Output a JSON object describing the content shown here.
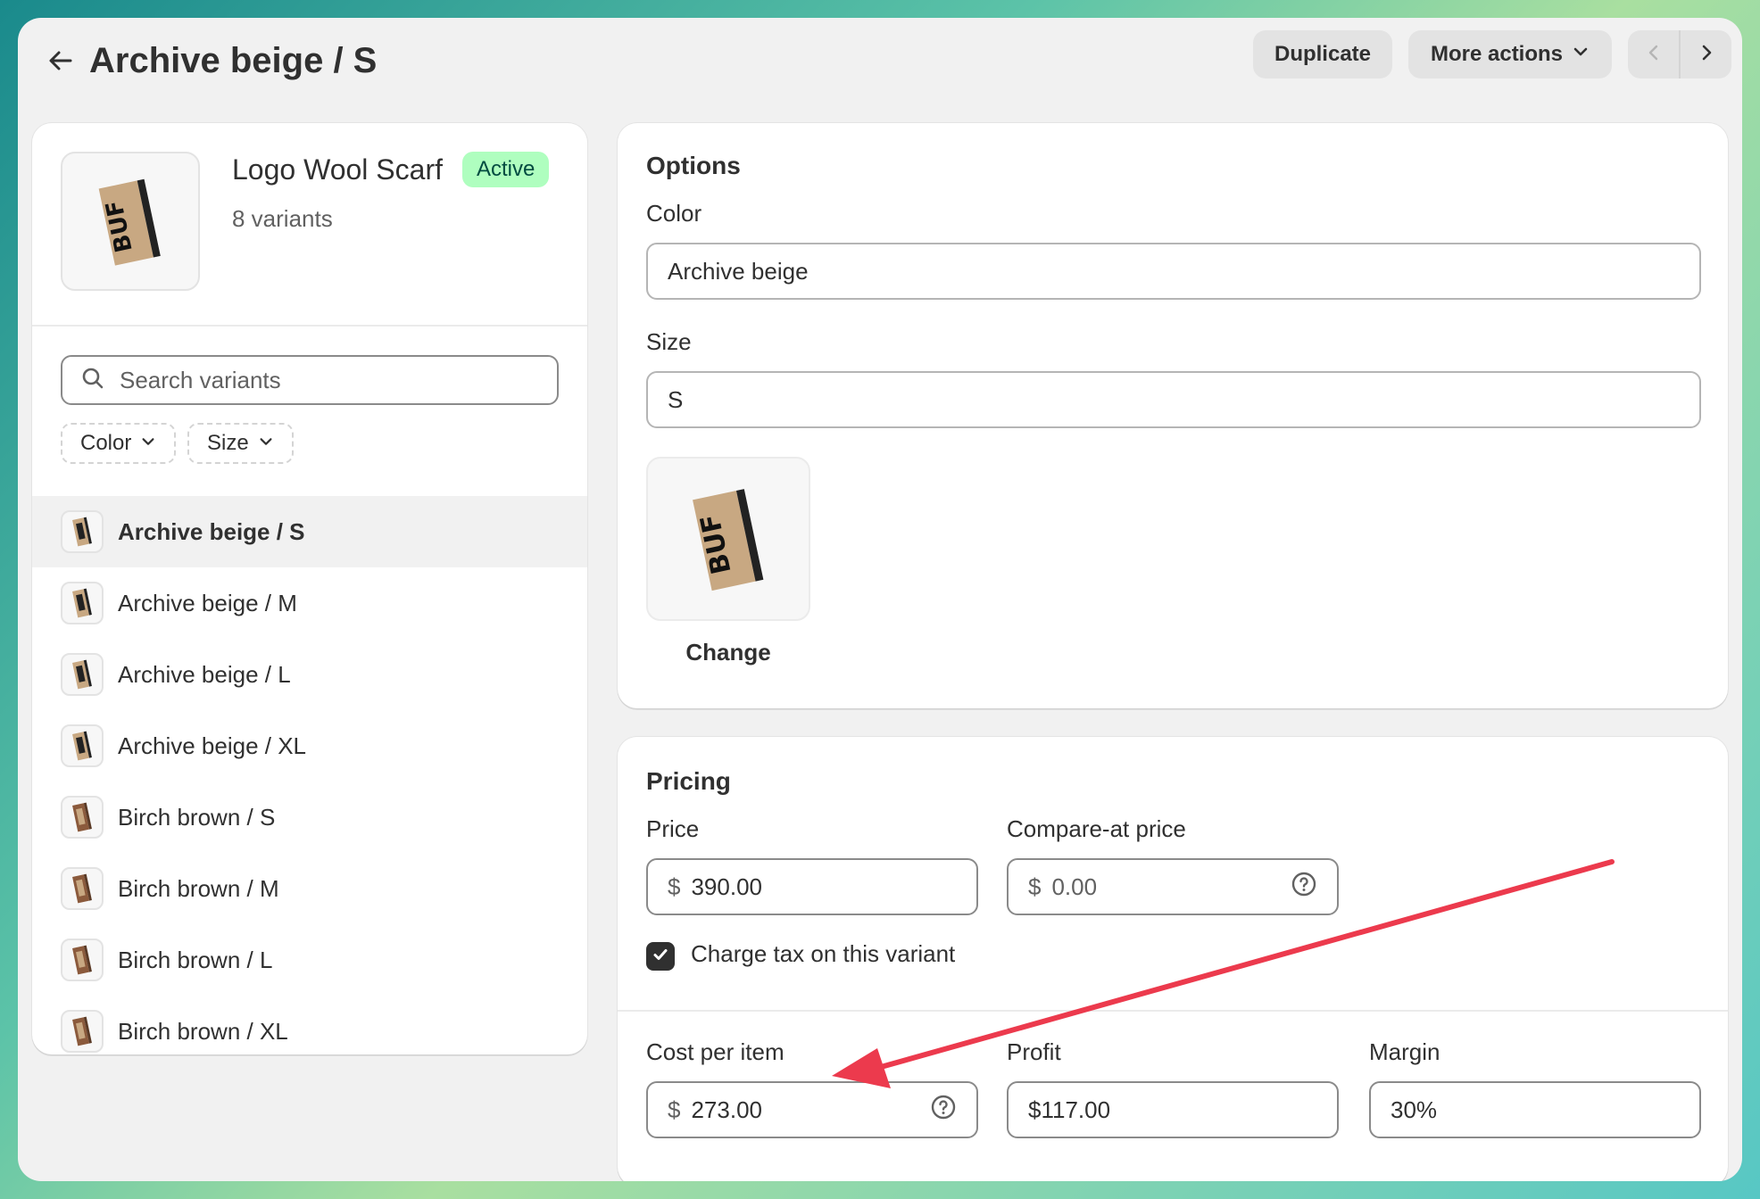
{
  "header": {
    "title": "Archive beige / S",
    "duplicate_label": "Duplicate",
    "more_actions_label": "More actions"
  },
  "product": {
    "name": "Logo Wool Scarf",
    "status": "Active",
    "variant_count": "8 variants",
    "image_text": "BUF"
  },
  "search": {
    "placeholder": "Search variants"
  },
  "filters": {
    "color": "Color",
    "size": "Size"
  },
  "variants": [
    {
      "label": "Archive beige / S",
      "color": "#c8a882",
      "selected": true
    },
    {
      "label": "Archive beige / M",
      "color": "#c8a882"
    },
    {
      "label": "Archive beige / L",
      "color": "#c8a882"
    },
    {
      "label": "Archive beige / XL",
      "color": "#c8a882"
    },
    {
      "label": "Birch brown / S",
      "color": "#8b5a3c"
    },
    {
      "label": "Birch brown / M",
      "color": "#8b5a3c"
    },
    {
      "label": "Birch brown / L",
      "color": "#8b5a3c"
    },
    {
      "label": "Birch brown / XL",
      "color": "#8b5a3c"
    }
  ],
  "options": {
    "title": "Options",
    "color_label": "Color",
    "color_value": "Archive beige",
    "size_label": "Size",
    "size_value": "S",
    "change_label": "Change"
  },
  "pricing": {
    "title": "Pricing",
    "price_label": "Price",
    "price_value": "390.00",
    "compare_label": "Compare-at price",
    "compare_value": "0.00",
    "currency": "$",
    "tax_label": "Charge tax on this variant",
    "tax_checked": true,
    "cost_label": "Cost per item",
    "cost_value": "273.00",
    "profit_label": "Profit",
    "profit_value": "$117.00",
    "margin_label": "Margin",
    "margin_value": "30%"
  },
  "colors": {
    "annotation_arrow": "#ec3a4d",
    "badge_bg": "#affebf",
    "badge_text": "#014b40",
    "scarf_beige": "#c8a882"
  }
}
